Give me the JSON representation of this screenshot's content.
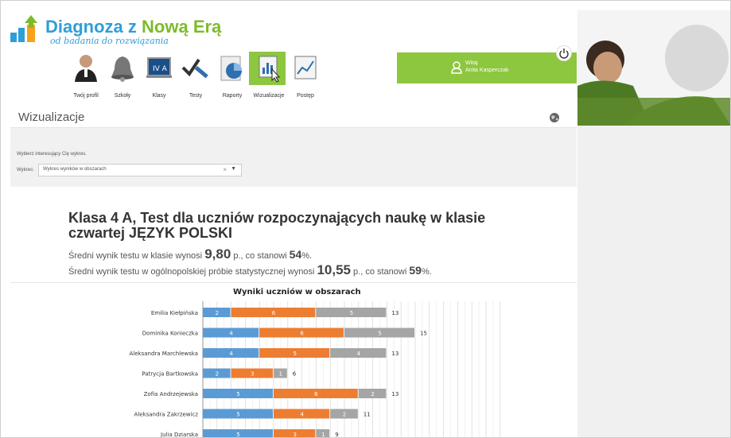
{
  "logo": {
    "title_blue": "Diagnoza z",
    "title_green": "Nową Erą",
    "subtitle": "od badania do rozwiązania"
  },
  "nav": [
    {
      "label": "Twój profil",
      "icon": "person-icon"
    },
    {
      "label": "Szkoły",
      "icon": "bell-icon"
    },
    {
      "label": "Klasy",
      "icon": "class-board-icon"
    },
    {
      "label": "Testy",
      "icon": "check-pen-icon"
    },
    {
      "label": "Raporty",
      "icon": "pie-report-icon"
    },
    {
      "label": "Wizualizacje",
      "icon": "chart-cursor-icon",
      "active": true
    },
    {
      "label": "Postęp",
      "icon": "line-chart-icon"
    }
  ],
  "user": {
    "greeting": "Witaj",
    "name": "Anita Kasperczak"
  },
  "page_title": "Wizualizacje",
  "filter": {
    "hint": "Wybierz interesujący Cię wykres.",
    "label": "Wykres:",
    "selected": "Wykres wyników w obszarach",
    "clear": "×",
    "arrow": "▼"
  },
  "report": {
    "title": "Klasa 4 A, Test dla uczniów rozpoczynających naukę w klasie czwartej JĘZYK POLSKI",
    "stat1": {
      "pre": "Średni wynik testu w klasie wynosi ",
      "value": "9,80",
      "mid": " p., co stanowi ",
      "pct": "54",
      "post": "%."
    },
    "stat2": {
      "pre": "Średni wynik testu w ogólnopolskiej próbie statystycznej wynosi ",
      "value": "10,55",
      "mid": " p., co stanowi ",
      "pct": "59",
      "post": "%."
    }
  },
  "colors": {
    "accent": "#8dc63f",
    "blue": "#5b9bd5",
    "orange": "#ed7d31",
    "gray": "#a5a5a5"
  },
  "chart_data": {
    "type": "bar",
    "stacked": true,
    "orientation": "horizontal",
    "title": "Wyniki uczniów w obszarach",
    "categories": [
      "Emilia Kiełpińska",
      "Dominika Konieczka",
      "Aleksandra Marchlewska",
      "Patrycja Bartkowska",
      "Zofia Andrzejewska",
      "Aleksandra Zakrzewicz",
      "Julia Dziarska"
    ],
    "series": [
      {
        "values": [
          2,
          4,
          4,
          2,
          5,
          5,
          5
        ],
        "color": "#5b9bd5"
      },
      {
        "values": [
          6,
          6,
          5,
          3,
          6,
          4,
          3
        ],
        "color": "#ed7d31"
      },
      {
        "values": [
          5,
          5,
          4,
          1,
          2,
          2,
          1
        ],
        "color": "#a5a5a5"
      }
    ],
    "totals": [
      13,
      15,
      13,
      6,
      13,
      11,
      9
    ],
    "grid": true
  }
}
